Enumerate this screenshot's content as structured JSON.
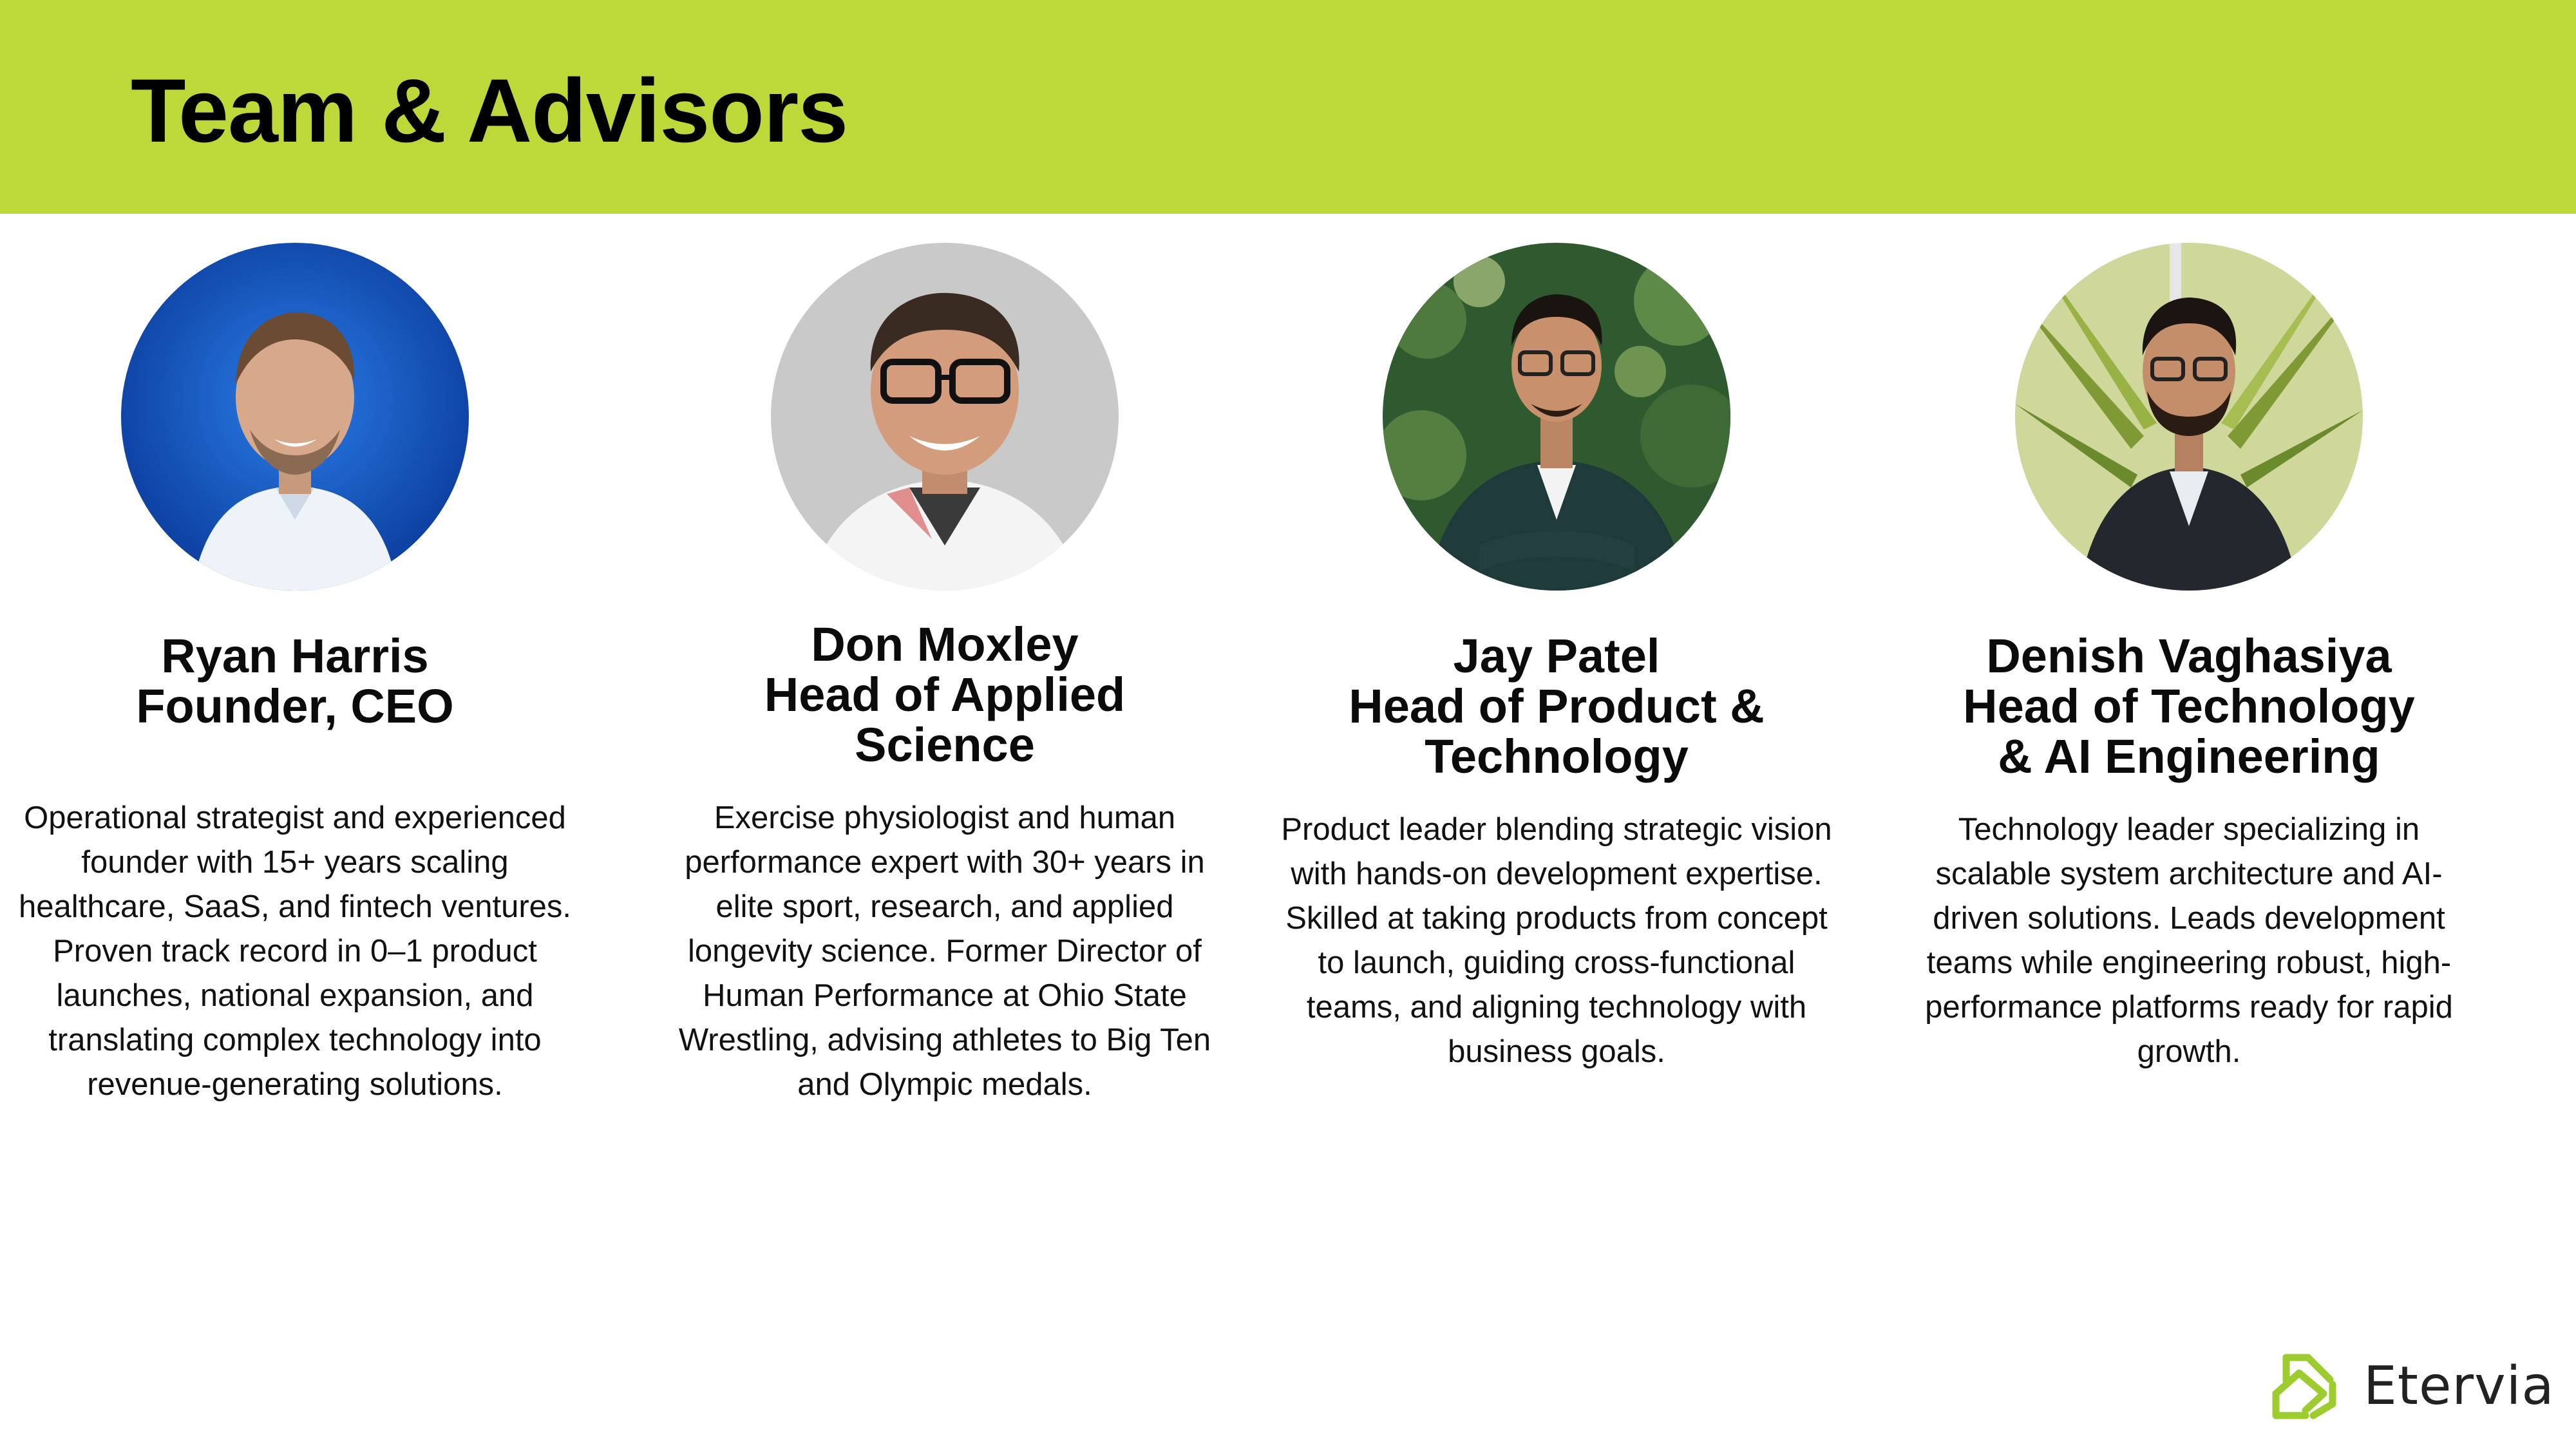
{
  "header": {
    "title": "Team & Advisors",
    "band_color": "#bdd839"
  },
  "members": [
    {
      "name": "Ryan Harris",
      "role_lines": [
        "Founder, CEO"
      ],
      "bio": "Operational strategist and experienced founder with 15+ years scaling healthcare, SaaS, and fintech ventures. Proven track record in 0–1 product launches, national expansion, and translating complex technology into revenue-generating solutions.",
      "photo_background": "#1550b8"
    },
    {
      "name": "Don Moxley",
      "role_lines": [
        "Head of Applied",
        "Science"
      ],
      "bio": "Exercise physiologist and human performance expert with 30+ years in elite sport, research, and applied longevity science. Former Director of Human Performance at Ohio State Wrestling, advising athletes to Big Ten and Olympic medals.",
      "photo_background": "#c9c9c9"
    },
    {
      "name": "Jay Patel",
      "role_lines": [
        "Head of Product &",
        "Technology"
      ],
      "bio": "Product leader blending strategic vision with hands-on development expertise. Skilled at taking products from concept to launch, guiding cross-functional teams, and aligning technology with business goals.",
      "photo_background": "#3f6a3a"
    },
    {
      "name": "Denish Vaghasiya",
      "role_lines": [
        "Head of Technology",
        "& AI Engineering"
      ],
      "bio": "Technology leader specializing in scalable system architecture and AI-driven solutions. Leads development teams while engineering robust, high-performance platforms ready for rapid growth.",
      "photo_background": "#8fa64a"
    }
  ],
  "logo": {
    "text": "Etervia",
    "icon": "eternity-knot-icon",
    "color": "#9ccc2e"
  }
}
